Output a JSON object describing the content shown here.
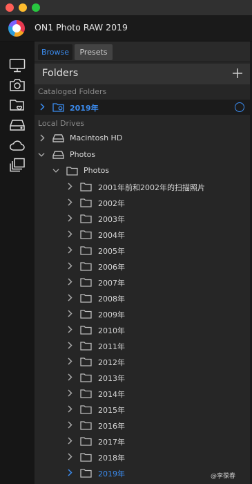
{
  "app": {
    "title": "ON1 Photo RAW 2019"
  },
  "sidebar_icons": [
    {
      "name": "monitor-icon"
    },
    {
      "name": "camera-icon"
    },
    {
      "name": "folder-heart-icon"
    },
    {
      "name": "drive-icon"
    },
    {
      "name": "cloud-icon"
    },
    {
      "name": "albums-icon"
    }
  ],
  "tabs": {
    "browse": "Browse",
    "presets": "Presets"
  },
  "folders": {
    "title": "Folders",
    "cataloged_label": "Cataloged Folders",
    "local_label": "Local Drives",
    "cataloged_item": "2019年",
    "drives": {
      "mac": "Macintosh HD",
      "photos": "Photos"
    },
    "photos_folder": "Photos",
    "subfolders": [
      "2001年前和2002年的扫描照片",
      "2002年",
      "2003年",
      "2004年",
      "2005年",
      "2006年",
      "2007年",
      "2008年",
      "2009年",
      "2010年",
      "2011年",
      "2012年",
      "2013年",
      "2014年",
      "2015年",
      "2016年",
      "2017年",
      "2018年",
      "2019年"
    ],
    "highlighted_subfolder": "2019年"
  },
  "colors": {
    "accent": "#3b8cf0",
    "panel": "#262626",
    "sidebar": "#161616"
  },
  "watermark": "@李葆春"
}
